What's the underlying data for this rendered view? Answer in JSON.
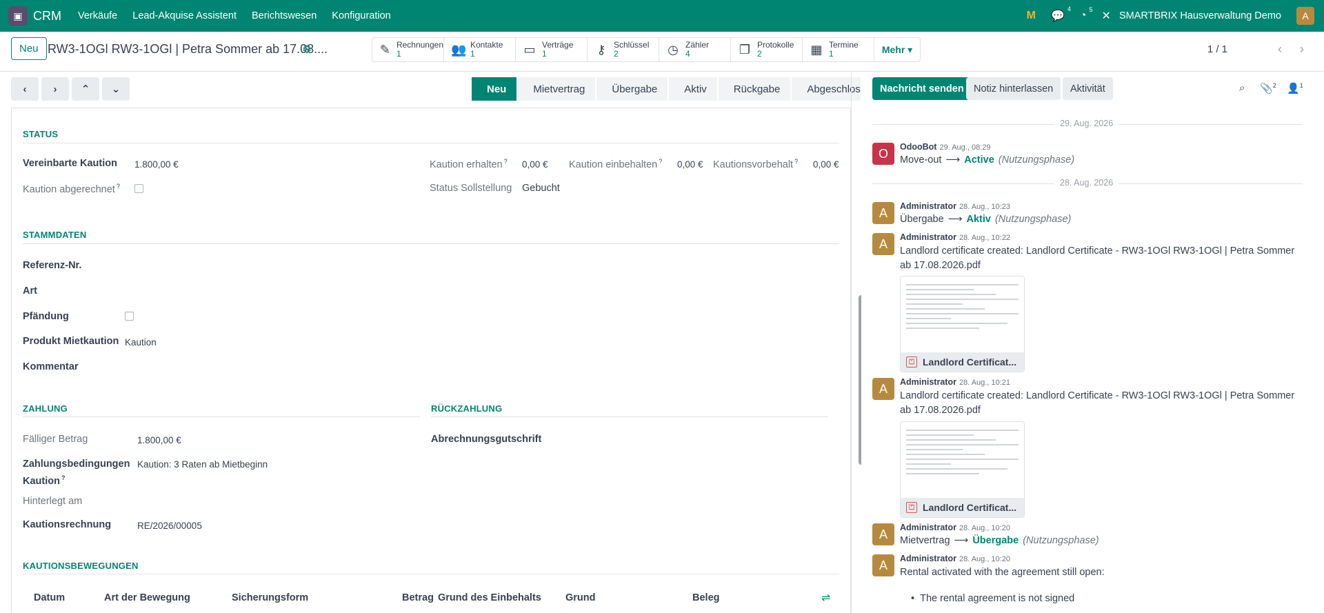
{
  "topbar": {
    "app_name": "CRM",
    "menu": [
      "Verkäufe",
      "Lead-Akquise Assistent",
      "Berichtswesen",
      "Konfiguration"
    ],
    "messages_count": "4",
    "activities_count": "5",
    "company": "SMARTBRIX Hausverwaltung Demo",
    "user_initial": "A"
  },
  "controlpanel": {
    "new_label": "Neu",
    "record_title": "RW3-1OGl RW3-1OGl | Petra Sommer ab 17.08....",
    "smart_buttons": [
      {
        "label": "Rechnungen",
        "count": "1",
        "icon": "invoice-icon"
      },
      {
        "label": "Kontakte",
        "count": "1",
        "icon": "users-icon"
      },
      {
        "label": "Verträge",
        "count": "1",
        "icon": "money-icon"
      },
      {
        "label": "Schlüssel",
        "count": "2",
        "icon": "key-icon"
      },
      {
        "label": "Zähler",
        "count": "4",
        "icon": "gauge-icon"
      },
      {
        "label": "Protokolle",
        "count": "2",
        "icon": "files-icon"
      },
      {
        "label": "Termine",
        "count": "1",
        "icon": "calendar-icon"
      }
    ],
    "more_label": "Mehr",
    "pager": "1 / 1"
  },
  "stages": [
    "Neu",
    "Mietvertrag",
    "Übergabe",
    "Aktiv",
    "Rückgabe",
    "Abgeschlossen"
  ],
  "active_stage": "Neu",
  "form": {
    "status": {
      "title": "STATUS",
      "vereinbarte_kaution_label": "Vereinbarte Kaution",
      "vereinbarte_kaution_value": "1.800,00 €",
      "kaution_abgerechnet_label": "Kaution abgerechnet",
      "kaution_erhalten_label": "Kaution erhalten",
      "kaution_erhalten_value": "0,00 €",
      "kaution_einbehalten_label": "Kaution einbehalten",
      "kaution_einbehalten_value": "0,00 €",
      "kautionsvorbehalt_label": "Kautionsvorbehalt",
      "kautionsvorbehalt_value": "0,00 €",
      "status_sollstellung_label": "Status Sollstellung",
      "status_sollstellung_value": "Gebucht"
    },
    "stammdaten": {
      "title": "STAMMDATEN",
      "referenz_label": "Referenz-Nr.",
      "art_label": "Art",
      "pfaendung_label": "Pfändung",
      "produkt_label": "Produkt Mietkaution",
      "produkt_value": "Kaution",
      "kommentar_label": "Kommentar"
    },
    "zahlung": {
      "title": "ZAHLUNG",
      "faelliger_label": "Fälliger Betrag",
      "faelliger_value": "1.800,00 €",
      "zahlungsbed_label_1": "Zahlungsbedingungen",
      "zahlungsbed_label_2": "Kaution",
      "zahlungsbed_value": "Kaution: 3 Raten ab Mietbeginn",
      "hinterlegt_label": "Hinterlegt am",
      "kautionsrechnung_label": "Kautionsrechnung",
      "kautionsrechnung_value": "RE/2026/00005"
    },
    "rueckzahlung": {
      "title": "RÜCKZAHLUNG",
      "abrechnung_label": "Abrechnungsgutschrift"
    },
    "bewegungen": {
      "title": "KAUTIONSBEWEGUNGEN",
      "columns": [
        "Datum",
        "Art der Bewegung",
        "Sicherungsform",
        "Betrag",
        "Grund des Einbehalts",
        "Grund",
        "Beleg"
      ]
    }
  },
  "chatter": {
    "send_label": "Nachricht senden",
    "note_label": "Notiz hinterlassen",
    "activity_label": "Aktivität",
    "attachments_count": "2",
    "followers_count": "1",
    "date_sep_1": "29. Aug. 2026",
    "date_sep_2": "28. Aug. 2026",
    "messages": [
      {
        "initial": "O",
        "author": "OdooBot",
        "time": "29. Aug., 08:29",
        "old": "Move-out",
        "new": "Active",
        "field": "(Nutzungsphase)"
      },
      {
        "initial": "A",
        "author": "Administrator",
        "time": "28. Aug., 10:23",
        "old": "Übergabe",
        "new": "Aktiv",
        "field": "(Nutzungsphase)"
      },
      {
        "initial": "A",
        "author": "Administrator",
        "time": "28. Aug., 10:22",
        "text": "Landlord certificate created: Landlord Certificate - RW3-1OGl RW3-1OGl | Petra Sommer ab 17.08.2026.pdf",
        "attachment": "Landlord Certificat..."
      },
      {
        "initial": "A",
        "author": "Administrator",
        "time": "28. Aug., 10:21",
        "text": "Landlord certificate created: Landlord Certificate - RW3-1OGl RW3-1OGl | Petra Sommer ab 17.08.2026.pdf",
        "attachment": "Landlord Certificat..."
      },
      {
        "initial": "A",
        "author": "Administrator",
        "time": "28. Aug., 10:20",
        "old": "Mietvertrag",
        "new": "Übergabe",
        "field": "(Nutzungsphase)"
      },
      {
        "initial": "A",
        "author": "Administrator",
        "time": "28. Aug., 10:20",
        "text": "Rental activated with the agreement still open:",
        "bullet": "The rental agreement is not signed"
      }
    ]
  },
  "colors": {
    "brand": "#018573",
    "odoobot": "#c8334b",
    "admin": "#b68a3e"
  }
}
